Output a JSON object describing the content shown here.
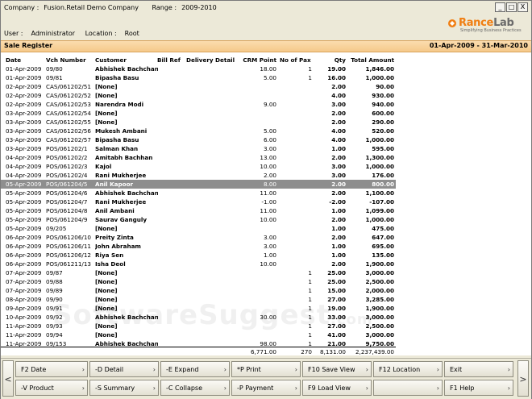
{
  "header": {
    "company_label": "Company :",
    "company": "Fusion.Retail Demo Company",
    "range_label": "Range :",
    "range": "2009-2010",
    "user_label": "User :",
    "user": "Administrator",
    "location_label": "Location :",
    "location": "Root"
  },
  "window_buttons": {
    "minimize": "_",
    "restore": "□",
    "close": "X"
  },
  "logo": {
    "brand_a": "Rance",
    "brand_b": "Lab",
    "tagline": "Simplifying Business Practices"
  },
  "report": {
    "title": "Sale Register",
    "period": "01-Apr-2009 - 31-Mar-2010"
  },
  "columns": [
    "Date",
    "Vch Number",
    "Customer",
    "Bill Ref",
    "Delivery Detail",
    "CRM Point",
    "No of Pax",
    "Qty",
    "Total Amount"
  ],
  "rows": [
    [
      "01-Apr-2009",
      "09/80",
      "Abhishek Bachchan",
      "",
      "",
      "18.00",
      "1",
      "19.00",
      "1,846.00"
    ],
    [
      "01-Apr-2009",
      "09/81",
      "Bipasha Basu",
      "",
      "",
      "5.00",
      "1",
      "16.00",
      "1,000.00"
    ],
    [
      "02-Apr-2009",
      "CAS/061202/51",
      "[None]",
      "",
      "",
      "",
      "",
      "2.00",
      "90.00"
    ],
    [
      "02-Apr-2009",
      "CAS/061202/52",
      "[None]",
      "",
      "",
      "",
      "",
      "4.00",
      "930.00"
    ],
    [
      "02-Apr-2009",
      "CAS/061202/53",
      "Narendra Modi",
      "",
      "",
      "9.00",
      "",
      "3.00",
      "940.00"
    ],
    [
      "03-Apr-2009",
      "CAS/061202/54",
      "[None]",
      "",
      "",
      "",
      "",
      "2.00",
      "600.00"
    ],
    [
      "03-Apr-2009",
      "CAS/061202/55",
      "[None]",
      "",
      "",
      "",
      "",
      "2.00",
      "290.00"
    ],
    [
      "03-Apr-2009",
      "CAS/061202/56",
      "Mukesh Ambani",
      "",
      "",
      "5.00",
      "",
      "4.00",
      "520.00"
    ],
    [
      "03-Apr-2009",
      "CAS/061202/57",
      "Bipasha Basu",
      "",
      "",
      "6.00",
      "",
      "4.00",
      "1,000.00"
    ],
    [
      "03-Apr-2009",
      "POS/061202/1",
      "Salman Khan",
      "",
      "",
      "3.00",
      "",
      "1.00",
      "595.00"
    ],
    [
      "04-Apr-2009",
      "POS/061202/2",
      "Amitabh Bachhan",
      "",
      "",
      "13.00",
      "",
      "2.00",
      "1,300.00"
    ],
    [
      "04-Apr-2009",
      "POS/061202/3",
      "Kajol",
      "",
      "",
      "10.00",
      "",
      "3.00",
      "1,000.00"
    ],
    [
      "04-Apr-2009",
      "POS/061202/4",
      "Rani Mukherjee",
      "",
      "",
      "2.00",
      "",
      "3.00",
      "176.00"
    ],
    [
      "05-Apr-2009",
      "POS/061204/5",
      "Anil Kapoor",
      "",
      "",
      "8.00",
      "",
      "2.00",
      "800.00"
    ],
    [
      "05-Apr-2009",
      "POS/061204/6",
      "Abhishek Bachchan",
      "",
      "",
      "11.00",
      "",
      "2.00",
      "1,100.00"
    ],
    [
      "05-Apr-2009",
      "POS/061204/7",
      "Rani Mukherjee",
      "",
      "",
      "-1.00",
      "",
      "-2.00",
      "-107.00"
    ],
    [
      "05-Apr-2009",
      "POS/061204/8",
      "Anil Ambani",
      "",
      "",
      "11.00",
      "",
      "1.00",
      "1,099.00"
    ],
    [
      "05-Apr-2009",
      "POS/061204/9",
      "Saurav Ganguly",
      "",
      "",
      "10.00",
      "",
      "2.00",
      "1,000.00"
    ],
    [
      "05-Apr-2009",
      "09/205",
      "[None]",
      "",
      "",
      "",
      "",
      "1.00",
      "475.00"
    ],
    [
      "06-Apr-2009",
      "POS/061206/10",
      "Preity Zinta",
      "",
      "",
      "3.00",
      "",
      "2.00",
      "647.00"
    ],
    [
      "06-Apr-2009",
      "POS/061206/11",
      "John Abraham",
      "",
      "",
      "3.00",
      "",
      "1.00",
      "695.00"
    ],
    [
      "06-Apr-2009",
      "POS/061206/12",
      "Riya Sen",
      "",
      "",
      "1.00",
      "",
      "1.00",
      "135.00"
    ],
    [
      "06-Apr-2009",
      "POS/061211/13",
      "Isha Deol",
      "",
      "",
      "10.00",
      "",
      "2.00",
      "1,900.00"
    ],
    [
      "07-Apr-2009",
      "09/87",
      "[None]",
      "",
      "",
      "",
      "1",
      "25.00",
      "3,000.00"
    ],
    [
      "07-Apr-2009",
      "09/88",
      "[None]",
      "",
      "",
      "",
      "1",
      "25.00",
      "2,500.00"
    ],
    [
      "07-Apr-2009",
      "09/89",
      "[None]",
      "",
      "",
      "",
      "1",
      "15.00",
      "2,000.00"
    ],
    [
      "08-Apr-2009",
      "09/90",
      "[None]",
      "",
      "",
      "",
      "1",
      "27.00",
      "3,285.00"
    ],
    [
      "09-Apr-2009",
      "09/91",
      "[None]",
      "",
      "",
      "",
      "1",
      "19.00",
      "1,900.00"
    ],
    [
      "10-Apr-2009",
      "09/92",
      "Abhishek Bachchan",
      "",
      "",
      "30.00",
      "1",
      "33.00",
      "3,000.00"
    ],
    [
      "11-Apr-2009",
      "09/93",
      "[None]",
      "",
      "",
      "",
      "1",
      "27.00",
      "2,500.00"
    ],
    [
      "11-Apr-2009",
      "09/94",
      "[None]",
      "",
      "",
      "",
      "1",
      "41.00",
      "3,000.00"
    ],
    [
      "11-Apr-2009",
      "09/153",
      "Abhishek Bachchan",
      "",
      "",
      "98.00",
      "1",
      "21.00",
      "9,750.00"
    ]
  ],
  "highlighted_row": 13,
  "totals": {
    "crm": "6,771.00",
    "pax": "270",
    "qty": "8,131.00",
    "amount": "2,237,439.00"
  },
  "watermark": {
    "main": "SoftwareSuggest",
    "suffix": ".com"
  },
  "buttons": {
    "row1": [
      "F2 Date",
      "-D Detail",
      "-E Expand",
      "*P Print",
      "F10 Save View",
      "F12 Location",
      "Exit"
    ],
    "row2": [
      "-V Product",
      "-S Summary",
      "-C Collapse",
      "-P Payment",
      "F9 Load View",
      "",
      "F1 Help"
    ],
    "nav_left": "<",
    "nav_right": ">"
  },
  "colors": {
    "title_bar": "#f5c98a",
    "highlight_row": "#8e8e8e",
    "brand_orange": "#f07e12"
  }
}
